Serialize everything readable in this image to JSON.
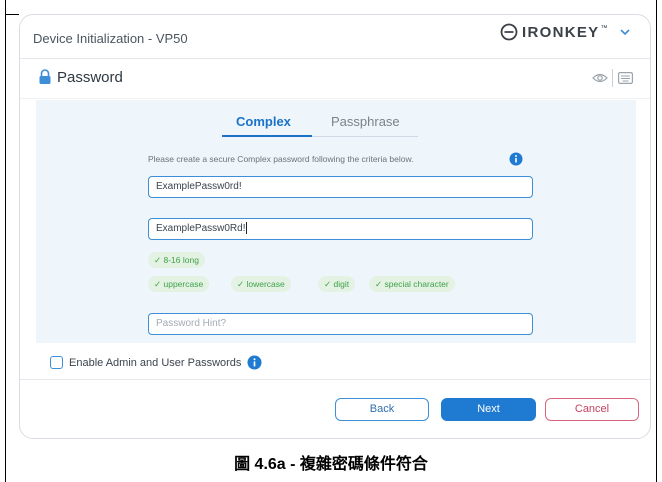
{
  "window": {
    "title": "Device Initialization - VP50",
    "brand": "IRONKEY",
    "brand_tm": "™"
  },
  "section": {
    "title": "Password",
    "icons": [
      "lock-icon",
      "eye-icon",
      "keyboard-icon"
    ]
  },
  "tabs": [
    {
      "label": "Complex",
      "active": true
    },
    {
      "label": "Passphrase",
      "active": false
    }
  ],
  "form": {
    "instructions": "Please create a secure Complex password following the criteria below.",
    "password_value": "ExamplePassw0rd!",
    "confirm_value": "ExamplePassw0Rd!",
    "hint_placeholder": "Password Hint?"
  },
  "criteria": {
    "length": "✓ 8-16 long",
    "uppercase": "✓ uppercase",
    "lowercase": "✓ lowercase",
    "digit": "✓ digit",
    "special": "✓ special character"
  },
  "options": {
    "enable_admin_user_label": "Enable Admin and User Passwords",
    "enable_admin_user_checked": false
  },
  "buttons": {
    "back": "Back",
    "next": "Next",
    "cancel": "Cancel"
  },
  "caption": "圖 4.6a - 複雜密碼條件符合",
  "colors": {
    "accent": "#1f7ad1",
    "success": "#3fa24a",
    "success_bg": "#e3f2e3",
    "cancel": "#d9647e",
    "content_bg": "#eef5fb"
  }
}
